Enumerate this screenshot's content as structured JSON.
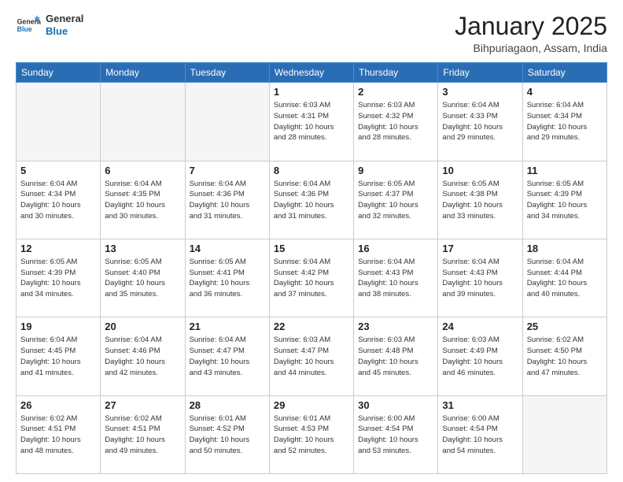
{
  "header": {
    "logo_general": "General",
    "logo_blue": "Blue",
    "month": "January 2025",
    "location": "Bihpuriagaon, Assam, India"
  },
  "weekdays": [
    "Sunday",
    "Monday",
    "Tuesday",
    "Wednesday",
    "Thursday",
    "Friday",
    "Saturday"
  ],
  "weeks": [
    [
      {
        "day": "",
        "info": ""
      },
      {
        "day": "",
        "info": ""
      },
      {
        "day": "",
        "info": ""
      },
      {
        "day": "1",
        "info": "Sunrise: 6:03 AM\nSunset: 4:31 PM\nDaylight: 10 hours\nand 28 minutes."
      },
      {
        "day": "2",
        "info": "Sunrise: 6:03 AM\nSunset: 4:32 PM\nDaylight: 10 hours\nand 28 minutes."
      },
      {
        "day": "3",
        "info": "Sunrise: 6:04 AM\nSunset: 4:33 PM\nDaylight: 10 hours\nand 29 minutes."
      },
      {
        "day": "4",
        "info": "Sunrise: 6:04 AM\nSunset: 4:34 PM\nDaylight: 10 hours\nand 29 minutes."
      }
    ],
    [
      {
        "day": "5",
        "info": "Sunrise: 6:04 AM\nSunset: 4:34 PM\nDaylight: 10 hours\nand 30 minutes."
      },
      {
        "day": "6",
        "info": "Sunrise: 6:04 AM\nSunset: 4:35 PM\nDaylight: 10 hours\nand 30 minutes."
      },
      {
        "day": "7",
        "info": "Sunrise: 6:04 AM\nSunset: 4:36 PM\nDaylight: 10 hours\nand 31 minutes."
      },
      {
        "day": "8",
        "info": "Sunrise: 6:04 AM\nSunset: 4:36 PM\nDaylight: 10 hours\nand 31 minutes."
      },
      {
        "day": "9",
        "info": "Sunrise: 6:05 AM\nSunset: 4:37 PM\nDaylight: 10 hours\nand 32 minutes."
      },
      {
        "day": "10",
        "info": "Sunrise: 6:05 AM\nSunset: 4:38 PM\nDaylight: 10 hours\nand 33 minutes."
      },
      {
        "day": "11",
        "info": "Sunrise: 6:05 AM\nSunset: 4:39 PM\nDaylight: 10 hours\nand 34 minutes."
      }
    ],
    [
      {
        "day": "12",
        "info": "Sunrise: 6:05 AM\nSunset: 4:39 PM\nDaylight: 10 hours\nand 34 minutes."
      },
      {
        "day": "13",
        "info": "Sunrise: 6:05 AM\nSunset: 4:40 PM\nDaylight: 10 hours\nand 35 minutes."
      },
      {
        "day": "14",
        "info": "Sunrise: 6:05 AM\nSunset: 4:41 PM\nDaylight: 10 hours\nand 36 minutes."
      },
      {
        "day": "15",
        "info": "Sunrise: 6:04 AM\nSunset: 4:42 PM\nDaylight: 10 hours\nand 37 minutes."
      },
      {
        "day": "16",
        "info": "Sunrise: 6:04 AM\nSunset: 4:43 PM\nDaylight: 10 hours\nand 38 minutes."
      },
      {
        "day": "17",
        "info": "Sunrise: 6:04 AM\nSunset: 4:43 PM\nDaylight: 10 hours\nand 39 minutes."
      },
      {
        "day": "18",
        "info": "Sunrise: 6:04 AM\nSunset: 4:44 PM\nDaylight: 10 hours\nand 40 minutes."
      }
    ],
    [
      {
        "day": "19",
        "info": "Sunrise: 6:04 AM\nSunset: 4:45 PM\nDaylight: 10 hours\nand 41 minutes."
      },
      {
        "day": "20",
        "info": "Sunrise: 6:04 AM\nSunset: 4:46 PM\nDaylight: 10 hours\nand 42 minutes."
      },
      {
        "day": "21",
        "info": "Sunrise: 6:04 AM\nSunset: 4:47 PM\nDaylight: 10 hours\nand 43 minutes."
      },
      {
        "day": "22",
        "info": "Sunrise: 6:03 AM\nSunset: 4:47 PM\nDaylight: 10 hours\nand 44 minutes."
      },
      {
        "day": "23",
        "info": "Sunrise: 6:03 AM\nSunset: 4:48 PM\nDaylight: 10 hours\nand 45 minutes."
      },
      {
        "day": "24",
        "info": "Sunrise: 6:03 AM\nSunset: 4:49 PM\nDaylight: 10 hours\nand 46 minutes."
      },
      {
        "day": "25",
        "info": "Sunrise: 6:02 AM\nSunset: 4:50 PM\nDaylight: 10 hours\nand 47 minutes."
      }
    ],
    [
      {
        "day": "26",
        "info": "Sunrise: 6:02 AM\nSunset: 4:51 PM\nDaylight: 10 hours\nand 48 minutes."
      },
      {
        "day": "27",
        "info": "Sunrise: 6:02 AM\nSunset: 4:51 PM\nDaylight: 10 hours\nand 49 minutes."
      },
      {
        "day": "28",
        "info": "Sunrise: 6:01 AM\nSunset: 4:52 PM\nDaylight: 10 hours\nand 50 minutes."
      },
      {
        "day": "29",
        "info": "Sunrise: 6:01 AM\nSunset: 4:53 PM\nDaylight: 10 hours\nand 52 minutes."
      },
      {
        "day": "30",
        "info": "Sunrise: 6:00 AM\nSunset: 4:54 PM\nDaylight: 10 hours\nand 53 minutes."
      },
      {
        "day": "31",
        "info": "Sunrise: 6:00 AM\nSunset: 4:54 PM\nDaylight: 10 hours\nand 54 minutes."
      },
      {
        "day": "",
        "info": ""
      }
    ]
  ]
}
